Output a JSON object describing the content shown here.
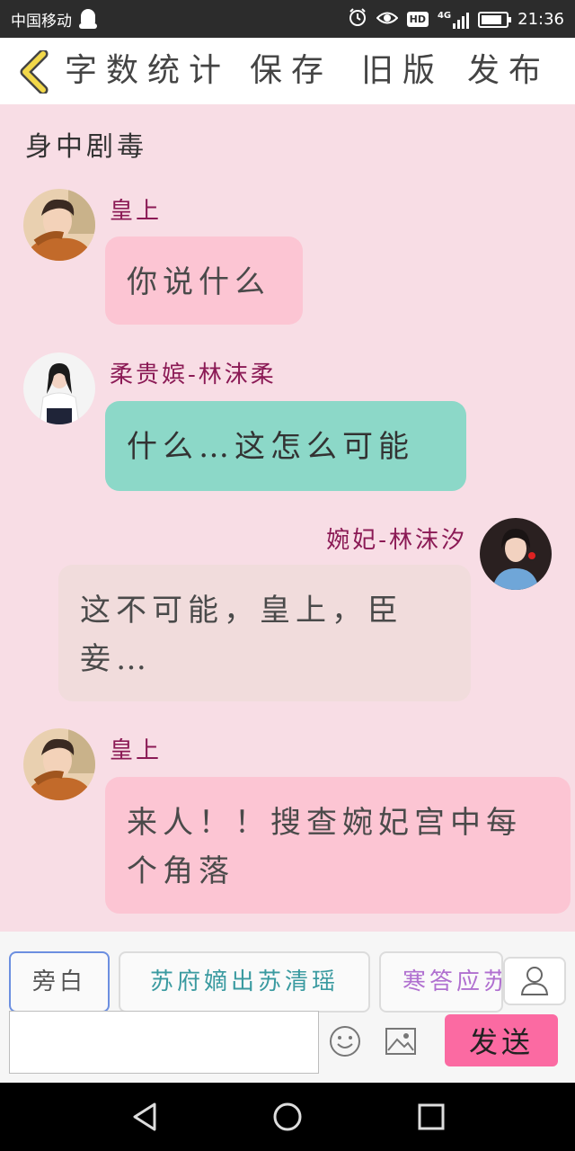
{
  "status_bar": {
    "carrier": "中国移动",
    "network": "4G",
    "hd": "HD",
    "time": "21:36",
    "battery_level": 0.85,
    "icons": [
      "qq-icon",
      "alarm-icon",
      "eye-icon",
      "hd-icon",
      "signal-icon",
      "battery-icon"
    ]
  },
  "toolbar": {
    "back_icon": "chevron-left-icon",
    "word_count": "字数统计",
    "save": "保存",
    "old_version": "旧版",
    "publish": "发布"
  },
  "chapter": {
    "title": "身中剧毒"
  },
  "messages": [
    {
      "side": "left",
      "speaker": "皇上",
      "text": "你说什么",
      "avatar": "emperor-avatar",
      "bubble": "pink"
    },
    {
      "side": "left",
      "speaker": "柔贵嫔-林沫柔",
      "text": "什么…这怎么可能",
      "avatar": "concubine-rou-avatar",
      "bubble": "teal"
    },
    {
      "side": "right",
      "speaker": "婉妃-林沫汐",
      "text": "这不可能，皇上，臣妾…",
      "avatar": "consort-wan-avatar",
      "bubble": "beige"
    },
    {
      "side": "left",
      "speaker": "皇上",
      "text": "来人！！搜查婉妃宫中每个角落",
      "avatar": "emperor-avatar",
      "bubble": "pink"
    }
  ],
  "composer": {
    "chips": [
      "旁白",
      "苏府嫡出苏清瑶",
      "寒答应苏"
    ],
    "input_value": "",
    "send_label": "发送",
    "icons": [
      "person-icon",
      "emoji-icon",
      "image-icon"
    ]
  },
  "nav": {
    "icons": [
      "back-triangle-icon",
      "home-circle-icon",
      "recents-square-icon"
    ]
  },
  "colors": {
    "background": "#f8dde5",
    "pink_bubble": "#fcc5d3",
    "teal_bubble": "#8cd8c8",
    "beige_bubble": "#f1dcdc",
    "name_color": "#8b1a55",
    "send_button": "#fb6aa2",
    "back_chevron": "#f2d84a"
  }
}
